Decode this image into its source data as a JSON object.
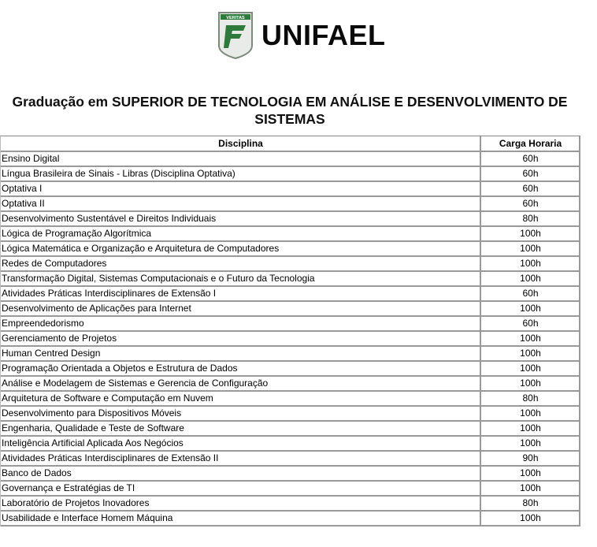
{
  "logo": {
    "shield_text": "VERITAS",
    "brand_name": "UNIFAEL",
    "colors": {
      "shield_fill": "#e9ebe9",
      "shield_border": "#7c8a7c",
      "emblem": "#2e7a3a",
      "brand_text": "#0a0a0a"
    }
  },
  "title": "Graduação em SUPERIOR DE TECNOLOGIA EM ANÁLISE E DESENVOLVIMENTO DE SISTEMAS",
  "table": {
    "headers": [
      "Disciplina",
      "Carga Horaria"
    ],
    "rows": [
      {
        "discipline": "Ensino Digital",
        "hours": "60h"
      },
      {
        "discipline": "Língua Brasileira de Sinais - Libras (Disciplina Optativa)",
        "hours": "60h"
      },
      {
        "discipline": "Optativa I",
        "hours": "60h"
      },
      {
        "discipline": "Optativa II",
        "hours": "60h"
      },
      {
        "discipline": "Desenvolvimento Sustentável e Direitos Individuais",
        "hours": "80h"
      },
      {
        "discipline": "Lógica de Programação Algorítmica",
        "hours": "100h"
      },
      {
        "discipline": "Lógica Matemática e Organização e Arquitetura de Computadores",
        "hours": "100h"
      },
      {
        "discipline": "Redes de Computadores",
        "hours": "100h"
      },
      {
        "discipline": "Transformação Digital, Sistemas Computacionais e o Futuro da Tecnologia",
        "hours": "100h"
      },
      {
        "discipline": "Atividades Práticas Interdisciplinares de Extensão I",
        "hours": "60h"
      },
      {
        "discipline": "Desenvolvimento de Aplicações para Internet",
        "hours": "100h"
      },
      {
        "discipline": "Empreendedorismo",
        "hours": "60h"
      },
      {
        "discipline": "Gerenciamento de Projetos",
        "hours": "100h"
      },
      {
        "discipline": "Human Centred Design",
        "hours": "100h"
      },
      {
        "discipline": "Programação Orientada a Objetos e Estrutura de Dados",
        "hours": "100h"
      },
      {
        "discipline": "Análise e Modelagem de Sistemas e Gerencia de Configuração",
        "hours": "100h"
      },
      {
        "discipline": "Arquitetura de Software e Computação em Nuvem",
        "hours": "80h"
      },
      {
        "discipline": "Desenvolvimento para Dispositivos Móveis",
        "hours": "100h"
      },
      {
        "discipline": "Engenharia, Qualidade e Teste de Software",
        "hours": "100h"
      },
      {
        "discipline": "Inteligência Artificial Aplicada Aos Negócios",
        "hours": "100h"
      },
      {
        "discipline": "Atividades Práticas Interdisciplinares de Extensão II",
        "hours": "90h"
      },
      {
        "discipline": "Banco de Dados",
        "hours": "100h"
      },
      {
        "discipline": "Governança e Estratégias de TI",
        "hours": "100h"
      },
      {
        "discipline": "Laboratório de Projetos Inovadores",
        "hours": "80h"
      },
      {
        "discipline": "Usabilidade e Interface Homem Máquina",
        "hours": "100h"
      }
    ]
  }
}
